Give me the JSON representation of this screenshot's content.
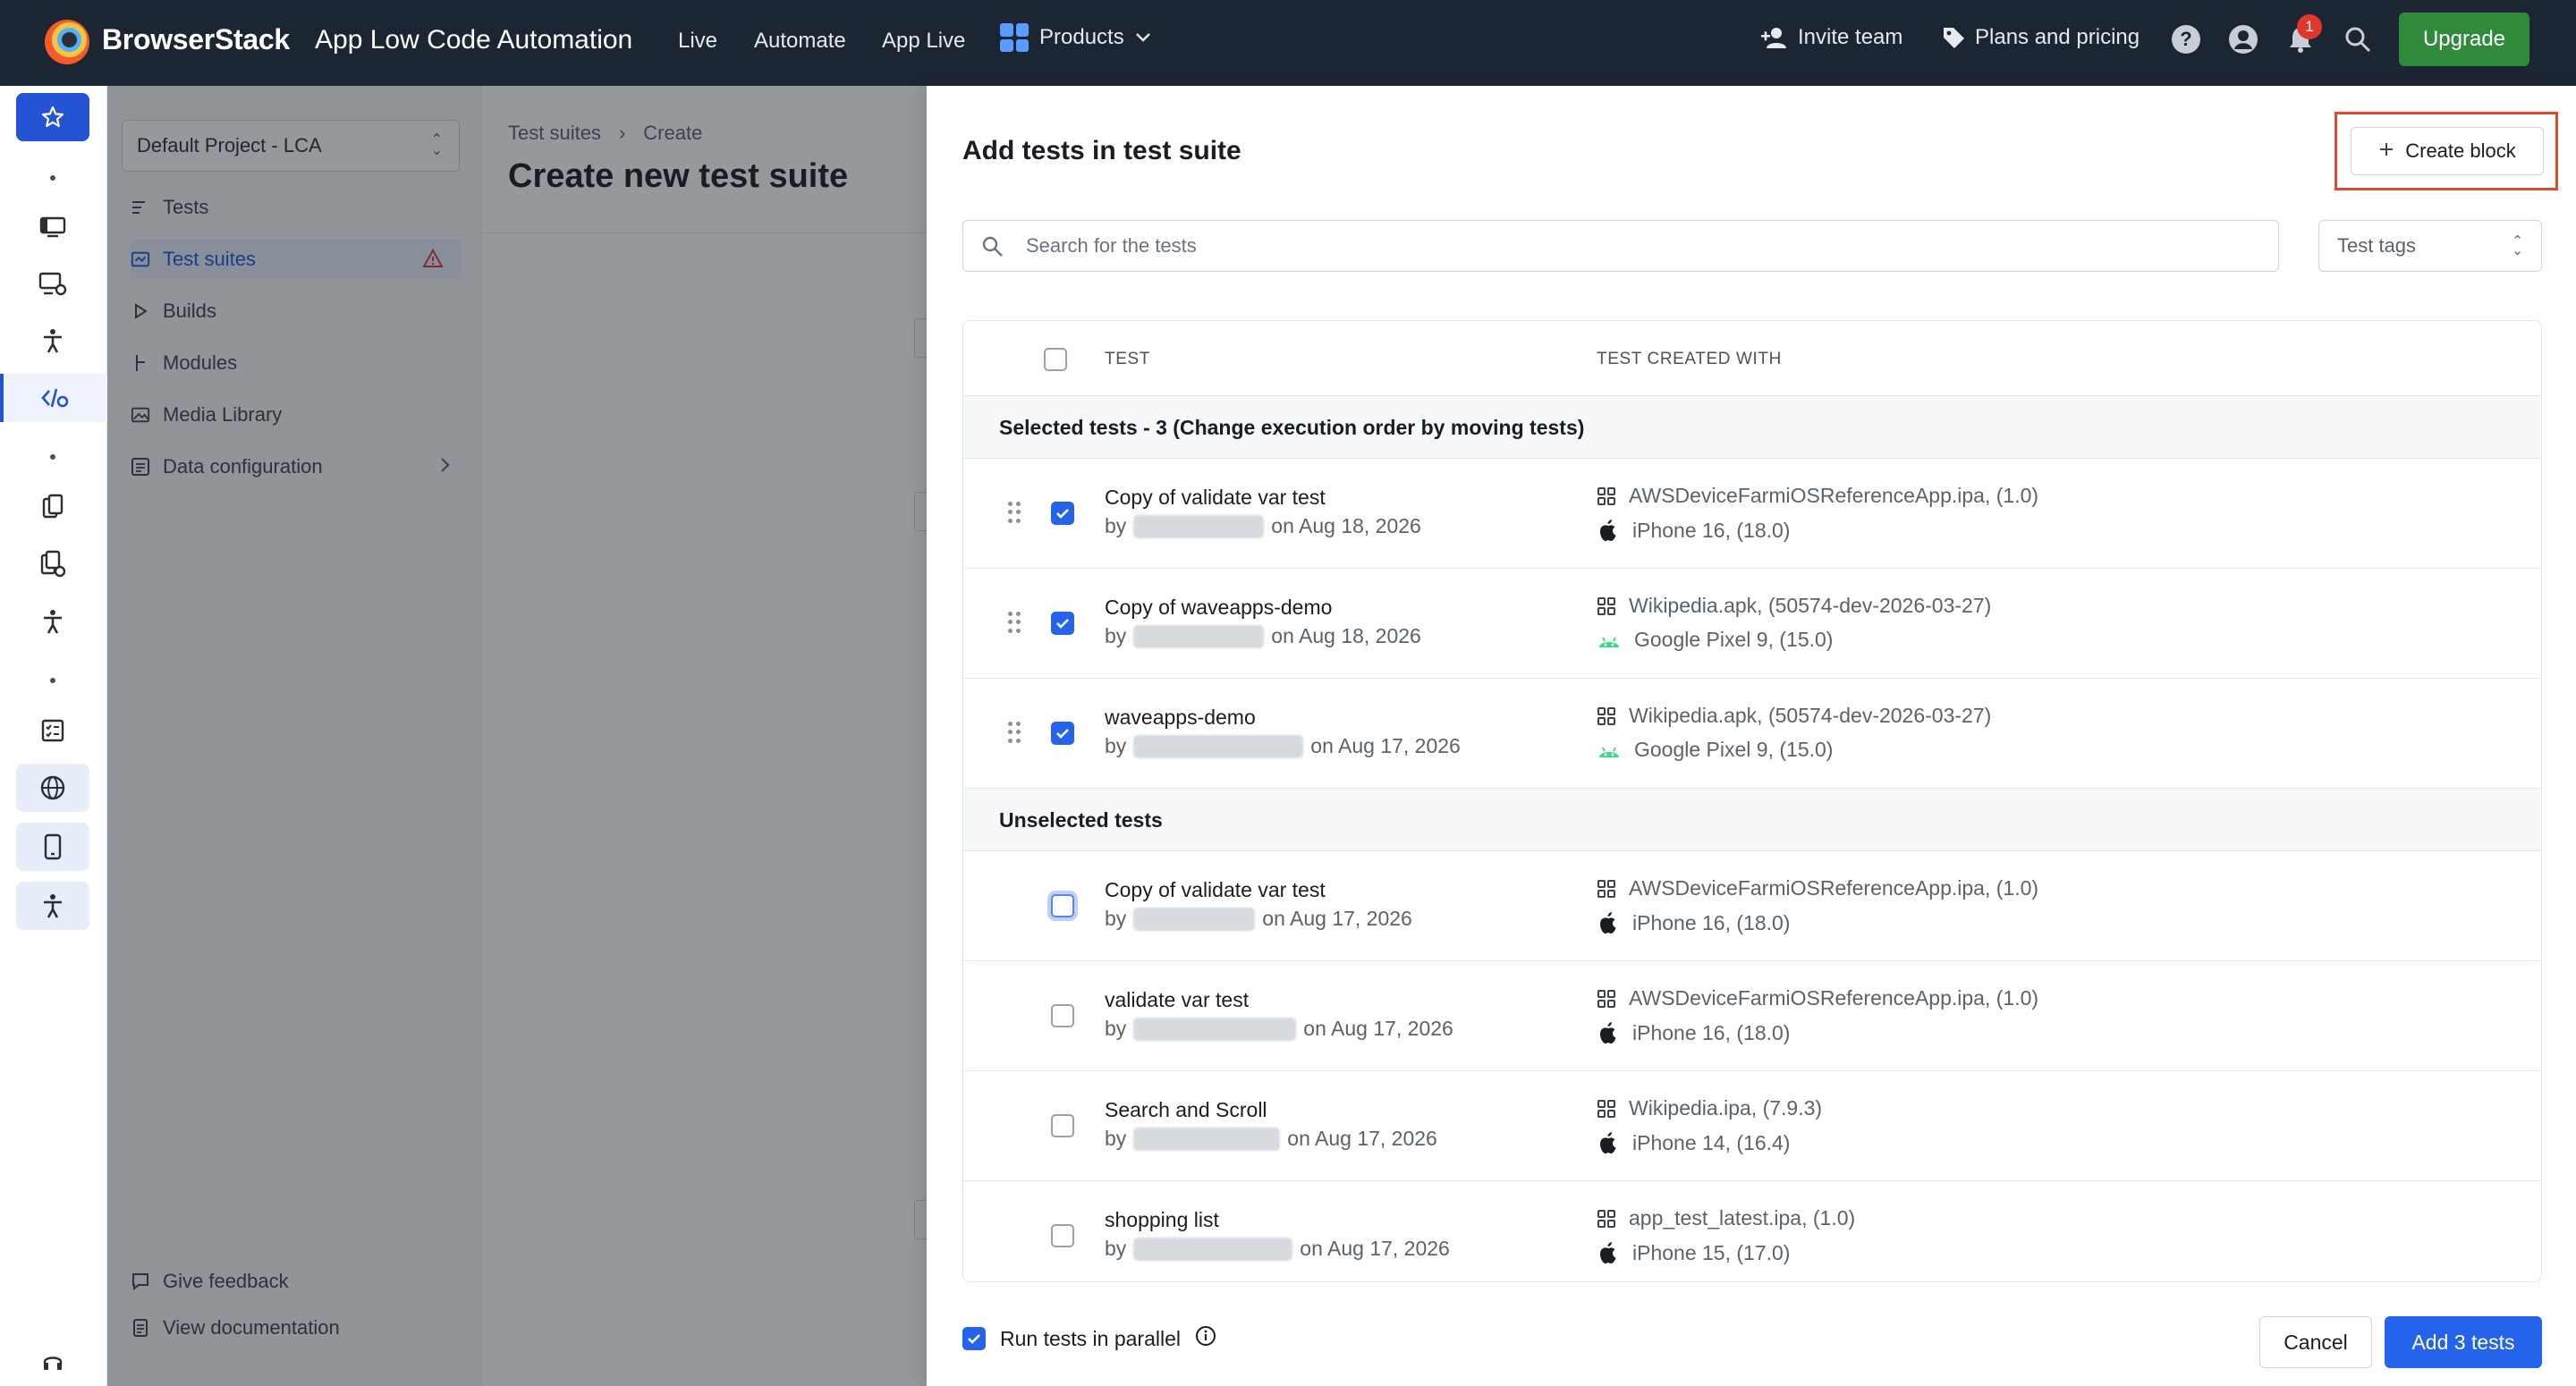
{
  "topbar": {
    "brand": "BrowserStack",
    "product": "App Low Code Automation",
    "nav": [
      "Live",
      "Automate",
      "App Live"
    ],
    "products_label": "Products",
    "invite_label": "Invite team",
    "pricing_label": "Plans and pricing",
    "notification_count": "1",
    "upgrade_label": "Upgrade",
    "accent_color": "#2f8a3c"
  },
  "rail": {
    "icons": [
      "star-icon",
      "device-icon",
      "device-settings-icon",
      "accessibility-icon",
      "code-icon",
      "copy-icon",
      "copy-settings-icon",
      "accessibility-icon",
      "checklist-icon",
      "globe-icon",
      "mobile-icon",
      "accessibility-icon",
      "headset-icon"
    ]
  },
  "leftnav": {
    "project": "Default Project - LCA",
    "items": [
      "Tests",
      "Test suites",
      "Builds",
      "Modules",
      "Media Library",
      "Data configuration"
    ],
    "active_item": "Test suites",
    "feedback": "Give feedback",
    "docs": "View documentation"
  },
  "main": {
    "breadcrumb": [
      "Test suites",
      "Create"
    ],
    "title": "Create new test suite"
  },
  "modal": {
    "title": "Add tests in test suite",
    "create_block_label": "Create block",
    "search_placeholder": "Search for the tests",
    "tags_placeholder": "Test tags",
    "columns": [
      "TEST",
      "TEST CREATED WITH"
    ],
    "selected_section": "Selected tests - 3 (Change execution order by moving tests)",
    "unselected_section": "Unselected tests",
    "selected_tests": [
      {
        "name": "Copy of validate var test",
        "by": "by",
        "date": "on Aug 18, 2026",
        "app": "AWSDeviceFarmiOSReferenceApp.ipa, (1.0)",
        "device": "iPhone 16, (18.0)",
        "platform": "apple-icon",
        "checked": true
      },
      {
        "name": "Copy of waveapps-demo",
        "by": "by",
        "date": "on Aug 18, 2026",
        "app": "Wikipedia.apk, (50574-dev-2026-03-27)",
        "device": "Google Pixel 9, (15.0)",
        "platform": "android-icon",
        "checked": true
      },
      {
        "name": "waveapps-demo",
        "by": "by",
        "date": "on Aug 17, 2026",
        "app": "Wikipedia.apk, (50574-dev-2026-03-27)",
        "device": "Google Pixel 9, (15.0)",
        "platform": "android-icon",
        "checked": true
      }
    ],
    "unselected_tests": [
      {
        "name": "Copy of validate var test",
        "by": "by",
        "date": "on Aug 17, 2026",
        "app": "AWSDeviceFarmiOSReferenceApp.ipa, (1.0)",
        "device": "iPhone 16, (18.0)",
        "platform": "apple-icon",
        "checked": false
      },
      {
        "name": "validate var test",
        "by": "by",
        "date": "on Aug 17, 2026",
        "app": "AWSDeviceFarmiOSReferenceApp.ipa, (1.0)",
        "device": "iPhone 16, (18.0)",
        "platform": "apple-icon",
        "checked": false
      },
      {
        "name": "Search and Scroll",
        "by": "by",
        "date": "on Aug 17, 2026",
        "app": "Wikipedia.ipa, (7.9.3)",
        "device": "iPhone 14, (16.4)",
        "platform": "apple-icon",
        "checked": false
      },
      {
        "name": "shopping list",
        "by": "by",
        "date": "on Aug 17, 2026",
        "app": "app_test_latest.ipa, (1.0)",
        "device": "iPhone 15, (17.0)",
        "platform": "apple-icon",
        "checked": false
      }
    ],
    "parallel_label": "Run tests in parallel",
    "parallel_checked": true,
    "cancel_label": "Cancel",
    "add_label": "Add 3 tests",
    "primary_color": "#2563eb",
    "highlight_color": "#e24a2c"
  }
}
